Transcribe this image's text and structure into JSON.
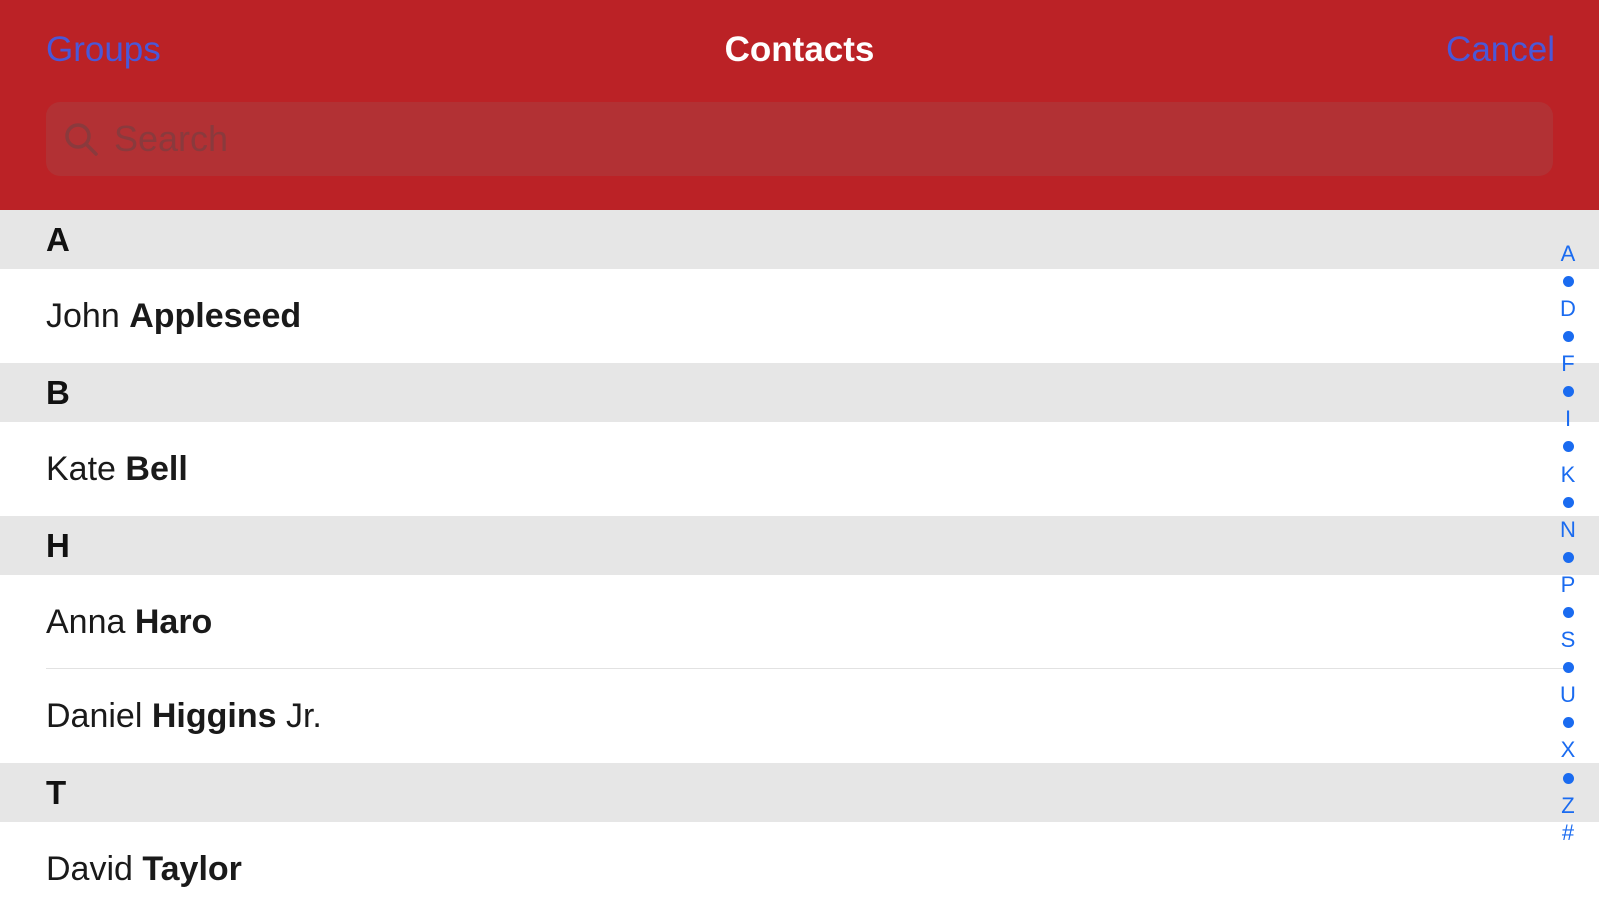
{
  "navbar": {
    "left_button": "Groups",
    "title": "Contacts",
    "right_button": "Cancel",
    "background_color": "#bb2226",
    "button_color": "#4a58d8"
  },
  "search": {
    "placeholder": "Search",
    "value": ""
  },
  "sections": [
    {
      "header": "A",
      "rows": [
        {
          "first": "John",
          "last": "Appleseed",
          "suffix": ""
        }
      ]
    },
    {
      "header": "B",
      "rows": [
        {
          "first": "Kate",
          "last": "Bell",
          "suffix": ""
        }
      ]
    },
    {
      "header": "H",
      "rows": [
        {
          "first": "Anna",
          "last": "Haro",
          "suffix": ""
        },
        {
          "first": "Daniel",
          "last": "Higgins",
          "suffix": "Jr."
        }
      ]
    },
    {
      "header": "T",
      "rows": [
        {
          "first": "David",
          "last": "Taylor",
          "suffix": ""
        }
      ]
    }
  ],
  "index": {
    "items": [
      "A",
      "•",
      "D",
      "•",
      "F",
      "•",
      "I",
      "•",
      "K",
      "•",
      "N",
      "•",
      "P",
      "•",
      "S",
      "•",
      "U",
      "•",
      "X",
      "•",
      "Z",
      "#"
    ],
    "color": "#1a6bf0"
  }
}
